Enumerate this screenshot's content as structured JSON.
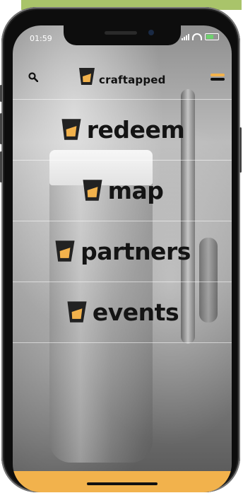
{
  "status_bar": {
    "time": "01:59"
  },
  "header": {
    "brand": "craftapped"
  },
  "menu": {
    "items": [
      {
        "label": "redeem"
      },
      {
        "label": "map"
      },
      {
        "label": "partners"
      },
      {
        "label": "events"
      }
    ]
  },
  "colors": {
    "accent": "#f2b24c",
    "top_band": "#a9c46a",
    "text": "#141414"
  },
  "icons": {
    "search": "search-icon",
    "menu": "hamburger-menu-icon",
    "brand": "beer-cup-logo-icon"
  }
}
